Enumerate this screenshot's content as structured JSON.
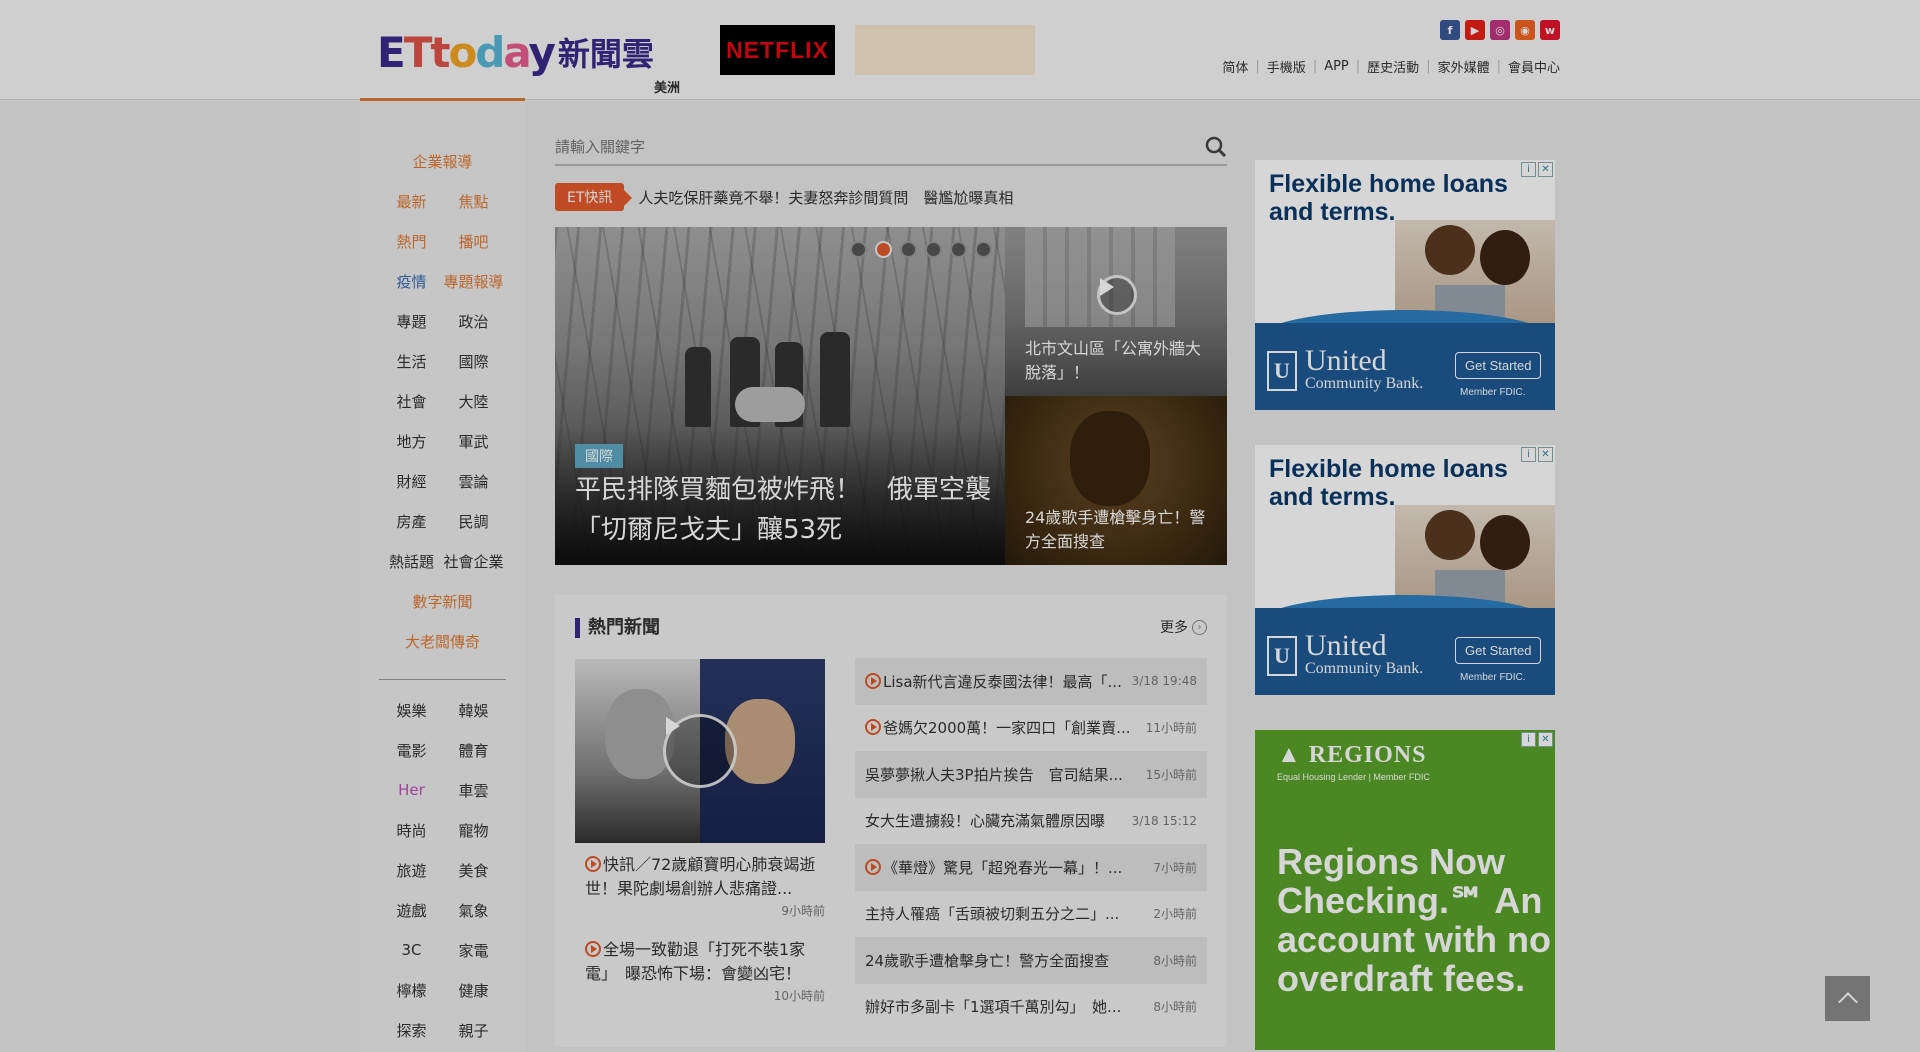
{
  "header": {
    "logo_text": "ETtoday",
    "logo_cn": "新聞雲",
    "region": "美洲",
    "netflix_label": "NETFLIX",
    "social_icons": [
      "facebook-icon",
      "youtube-icon",
      "instagram-icon",
      "rss-icon",
      "weibo-icon"
    ],
    "links": [
      "简体",
      "手機版",
      "APP",
      "歷史活動",
      "家外媒體",
      "會員中心"
    ]
  },
  "leftnav": {
    "rows": [
      [
        "企業報導"
      ],
      [
        "最新",
        "焦點"
      ],
      [
        "熱門",
        "播吧"
      ],
      [
        "疫情",
        "專題報導"
      ],
      [
        "專題",
        "政治"
      ],
      [
        "生活",
        "國際"
      ],
      [
        "社會",
        "大陸"
      ],
      [
        "地方",
        "軍武"
      ],
      [
        "財經",
        "雲論"
      ],
      [
        "房產",
        "民調"
      ],
      [
        "熱話題",
        "社會企業"
      ],
      [
        "數字新聞"
      ],
      [
        "大老闆傳奇"
      ]
    ],
    "rows2": [
      [
        "娛樂",
        "韓娛"
      ],
      [
        "電影",
        "體育"
      ],
      [
        "Her",
        "車雲"
      ],
      [
        "時尚",
        "寵物"
      ],
      [
        "旅遊",
        "美食"
      ],
      [
        "遊戲",
        "氣象"
      ],
      [
        "3C",
        "家電"
      ],
      [
        "檸檬",
        "健康"
      ],
      [
        "探索",
        "親子"
      ]
    ]
  },
  "search": {
    "placeholder": "請輸入關鍵字"
  },
  "flash": {
    "tag": "ET快訊",
    "text": "人夫吃保肝藥竟不舉！夫妻怒奔診間質問　醫尷尬曝真相"
  },
  "hero": {
    "category": "國際",
    "title": "平民排隊買麵包被炸飛！　俄軍空襲「切爾尼戈夫」釀53死",
    "slides": 6,
    "active_slide": 2
  },
  "side_stories": [
    {
      "title": "北市文山區「公寓外牆大脫落」！"
    },
    {
      "title": "24歲歌手遭槍擊身亡！警方全面搜查"
    }
  ],
  "hot": {
    "heading": "熱門新聞",
    "more": "更多",
    "featured": [
      {
        "title": "快訊／72歲顧寶明心肺衰竭逝世！果陀劇場創辦人悲痛證...",
        "time": "9小時前"
      },
      {
        "title": "全場一致勸退「打死不裝1家電」　曝恐怖下場：會變凶宅！",
        "time": "10小時前"
      }
    ],
    "list": [
      {
        "title": "Lisa新代言違反泰國法律！最高「...",
        "time": "3/18 19:48",
        "video": true
      },
      {
        "title": "爸媽欠2000萬！一家四口「創業賣...",
        "time": "11小時前",
        "video": true
      },
      {
        "title": "吳夢夢揪人夫3P拍片挨告　官司結果...",
        "time": "15小時前",
        "video": false
      },
      {
        "title": "女大生遭擄殺！心臟充滿氣體原因曝",
        "time": "3/18 15:12",
        "video": false
      },
      {
        "title": "《華燈》驚見「超兇春光一幕」！...",
        "time": "7小時前",
        "video": true
      },
      {
        "title": "主持人罹癌「舌頭被切剩五分之二」...",
        "time": "2小時前",
        "video": false
      },
      {
        "title": "24歲歌手遭槍擊身亡！警方全面搜查",
        "time": "8小時前",
        "video": false
      },
      {
        "title": "辦好市多副卡「1選項千萬別勾」　她...",
        "time": "8小時前",
        "video": false
      }
    ]
  },
  "ads": {
    "ub_headline_1": "Flexible home loans",
    "ub_headline_2": "and terms.",
    "ub_name_1": "United",
    "ub_name_2": "Community Bank.",
    "ub_button": "Get Started",
    "ub_fdic": "Member FDIC.",
    "regions_logo": "REGIONS",
    "regions_sub": "Equal Housing Lender | Member FDIC",
    "regions_text": "Regions Now Checking.℠ An account with no overdraft fees."
  },
  "colors": {
    "accent": "#e07a35",
    "brand": "#3a2a8a",
    "flash": "#e55a2b"
  }
}
